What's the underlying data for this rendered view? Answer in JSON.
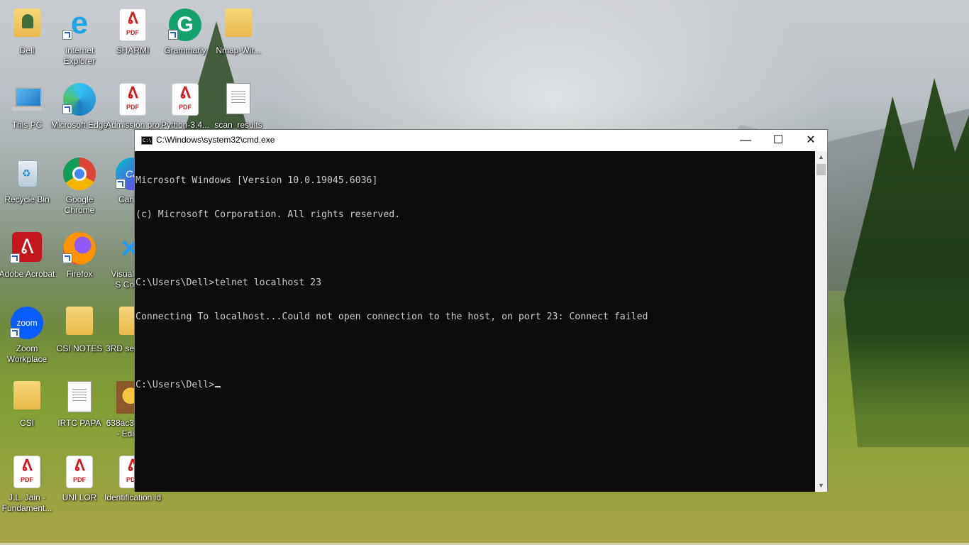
{
  "desktop": {
    "icons": [
      {
        "label": "Dell",
        "icon": "user-folder-icon"
      },
      {
        "label": "Internet Explorer",
        "icon": "internet-explorer-icon"
      },
      {
        "label": "SHARMI",
        "icon": "pdf-icon"
      },
      {
        "label": "Grammarly",
        "icon": "grammarly-icon"
      },
      {
        "label": "Nmap-Wir...",
        "icon": "folder-icon"
      },
      {
        "label": "This PC",
        "icon": "this-pc-icon"
      },
      {
        "label": "Microsoft Edge",
        "icon": "edge-icon"
      },
      {
        "label": "Admission pro",
        "icon": "pdf-icon"
      },
      {
        "label": "Python-3.4...",
        "icon": "pdf-icon"
      },
      {
        "label": "scan_results",
        "icon": "text-file-icon"
      },
      {
        "label": "Recycle Bin",
        "icon": "recycle-bin-icon"
      },
      {
        "label": "Google Chrome",
        "icon": "chrome-icon"
      },
      {
        "label": "Can",
        "icon": "canva-icon"
      },
      {
        "label": "Adobe Acrobat",
        "icon": "acrobat-icon"
      },
      {
        "label": "Firefox",
        "icon": "firefox-icon"
      },
      {
        "label": "Visual S Co",
        "icon": "vscode-icon"
      },
      {
        "label": "Zoom Workplace",
        "icon": "zoom-icon"
      },
      {
        "label": "CSI NOTES",
        "icon": "folder-icon"
      },
      {
        "label": "3RD se",
        "icon": "folder-icon"
      },
      {
        "label": "CSI",
        "icon": "folder-icon"
      },
      {
        "label": "IRTC PAPA",
        "icon": "text-file-icon"
      },
      {
        "label": "638ac3 - Edi",
        "icon": "image-icon"
      },
      {
        "label": "J.L. Jain - Fundament...",
        "icon": "pdf-icon"
      },
      {
        "label": "UNI LOR",
        "icon": "pdf-icon"
      },
      {
        "label": "Identification id",
        "icon": "pdf-icon"
      }
    ],
    "pdf_tag": "PDF",
    "zoom_text": "zoom"
  },
  "window": {
    "title": "C:\\Windows\\system32\\cmd.exe",
    "icon_text": "C:\\",
    "minimize": "—",
    "maximize": "☐",
    "close": "✕"
  },
  "console": {
    "lines": [
      "Microsoft Windows [Version 10.0.19045.6036]",
      "(c) Microsoft Corporation. All rights reserved.",
      "",
      "C:\\Users\\Dell>telnet localhost 23",
      "Connecting To localhost...Could not open connection to the host, on port 23: Connect failed",
      ""
    ],
    "prompt": "C:\\Users\\Dell>"
  },
  "scrollbar": {
    "up": "▲",
    "down": "▼"
  },
  "colors": {
    "console_bg": "#0c0c0c",
    "console_fg": "#cccccc",
    "pdf_red": "#d71921"
  }
}
